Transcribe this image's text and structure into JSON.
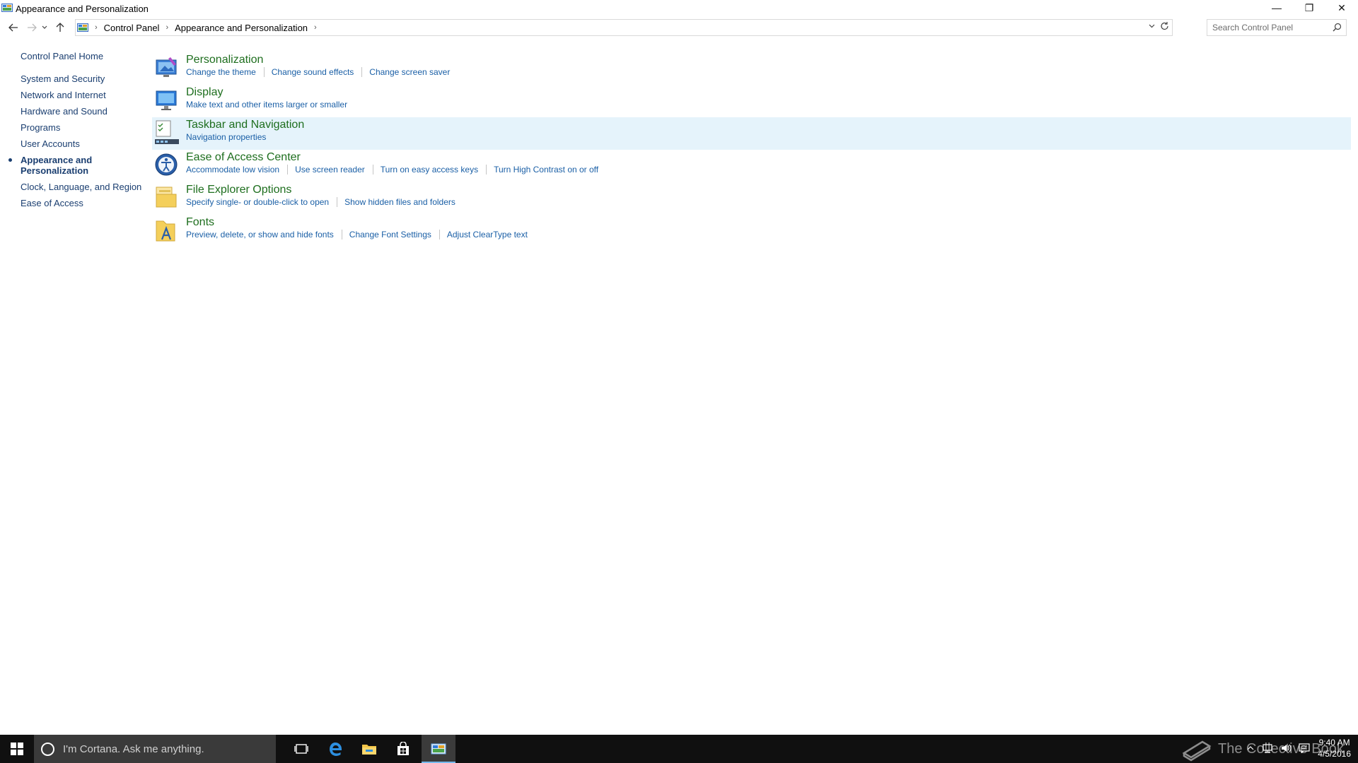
{
  "window": {
    "title": "Appearance and Personalization",
    "controls": {
      "minimize": "—",
      "restore": "❐",
      "close": "✕"
    }
  },
  "address": {
    "breadcrumbs": [
      "Control Panel",
      "Appearance and Personalization"
    ],
    "search_placeholder": "Search Control Panel"
  },
  "sidebar": {
    "home": "Control Panel Home",
    "items": [
      {
        "label": "System and Security"
      },
      {
        "label": "Network and Internet"
      },
      {
        "label": "Hardware and Sound"
      },
      {
        "label": "Programs"
      },
      {
        "label": "User Accounts"
      },
      {
        "label": "Appearance and Personalization",
        "active": true
      },
      {
        "label": "Clock, Language, and Region"
      },
      {
        "label": "Ease of Access"
      }
    ]
  },
  "categories": [
    {
      "title": "Personalization",
      "icon": "personalization-icon",
      "links": [
        "Change the theme",
        "Change sound effects",
        "Change screen saver"
      ]
    },
    {
      "title": "Display",
      "icon": "display-icon",
      "links": [
        "Make text and other items larger or smaller"
      ]
    },
    {
      "title": "Taskbar and Navigation",
      "icon": "taskbar-icon",
      "links": [
        "Navigation properties"
      ],
      "hover": true
    },
    {
      "title": "Ease of Access Center",
      "icon": "ease-of-access-icon",
      "links": [
        "Accommodate low vision",
        "Use screen reader",
        "Turn on easy access keys",
        "Turn High Contrast on or off"
      ]
    },
    {
      "title": "File Explorer Options",
      "icon": "folder-options-icon",
      "links": [
        "Specify single- or double-click to open",
        "Show hidden files and folders"
      ]
    },
    {
      "title": "Fonts",
      "icon": "fonts-icon",
      "links": [
        "Preview, delete, or show and hide fonts",
        "Change Font Settings",
        "Adjust ClearType text"
      ]
    }
  ],
  "taskbar": {
    "cortana_placeholder": "I'm Cortana. Ask me anything.",
    "apps": [
      "task-view-icon",
      "edge-icon",
      "file-explorer-icon",
      "store-icon",
      "control-panel-icon"
    ],
    "watermark": "The Collective Book",
    "time": "9:40 AM",
    "date": "4/5/2016"
  }
}
